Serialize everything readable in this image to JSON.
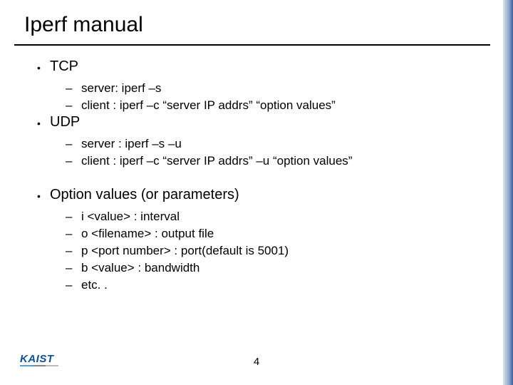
{
  "title": "Iperf manual",
  "sections": [
    {
      "label": "TCP",
      "items": [
        "server: iperf –s",
        "client : iperf –c “server IP addrs”  “option values”"
      ]
    },
    {
      "label": "UDP",
      "items": [
        "server : iperf –s –u",
        "client  : iperf –c “server IP addrs” –u “option values”"
      ]
    },
    {
      "label": "Option values (or parameters)",
      "gap": true,
      "items": [
        "i <value> : interval",
        "o <filename> : output file",
        "p <port number> : port(default is 5001)",
        "b <value> : bandwidth",
        "etc. ."
      ]
    }
  ],
  "logo_text": "KAIST",
  "page_number": "4"
}
